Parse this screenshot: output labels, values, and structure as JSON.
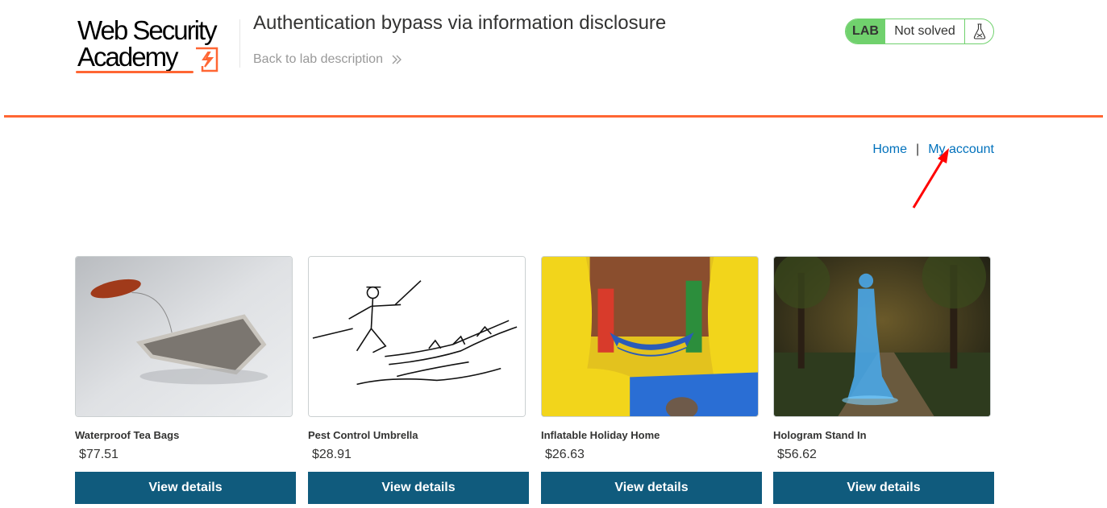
{
  "header": {
    "logo_line1": "Web Security",
    "logo_line2": "Academy",
    "lab_title": "Authentication bypass via information disclosure",
    "back_link": "Back to lab description",
    "status_badge": "LAB",
    "status_text": "Not solved",
    "status_icon": "flask-icon"
  },
  "nav": {
    "home": "Home",
    "separator": "|",
    "my_account": "My account"
  },
  "products": [
    {
      "name": "Waterproof Tea Bags",
      "price": "$77.51",
      "button": "View details",
      "image": "tea-bag-image"
    },
    {
      "name": "Pest Control Umbrella",
      "price": "$28.91",
      "button": "View details",
      "image": "umbrella-sketch-image"
    },
    {
      "name": "Inflatable Holiday Home",
      "price": "$26.63",
      "button": "View details",
      "image": "bouncy-castle-image"
    },
    {
      "name": "Hologram Stand In",
      "price": "$56.62",
      "button": "View details",
      "image": "hologram-woman-image"
    }
  ],
  "colors": {
    "accent": "#ff6633",
    "link": "#0071bc",
    "button": "#105b7d",
    "status_green": "#70d16d",
    "annotation_arrow": "#ff0000"
  }
}
